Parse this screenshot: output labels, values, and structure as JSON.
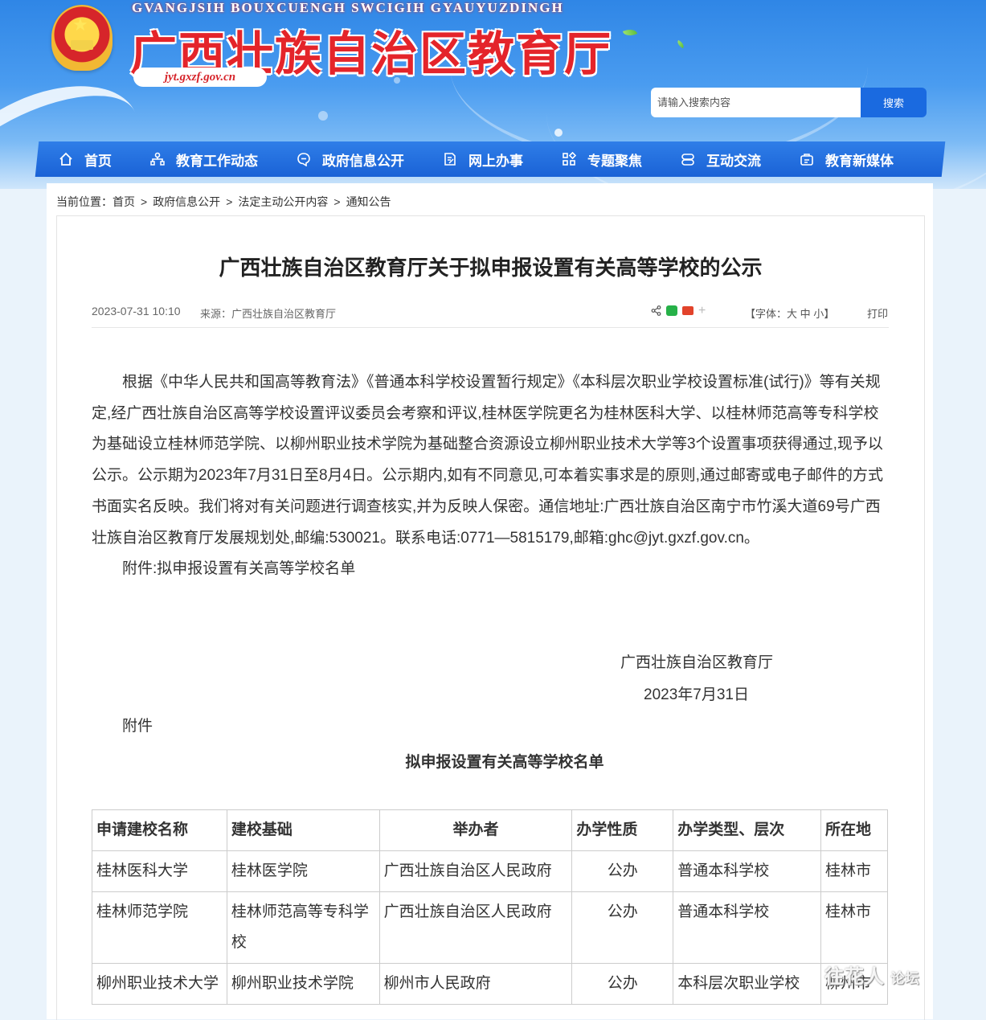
{
  "header": {
    "title": "广西壮族自治区教育厅",
    "subtitle": "GVANGJSIH BOUXCUENGH SWCIGIH GYAUYUZDINGH",
    "url": "jyt.gxzf.gov.cn"
  },
  "search": {
    "placeholder": "请输入搜索内容",
    "button": "搜索"
  },
  "nav": [
    {
      "label": "首页",
      "icon": "home-icon"
    },
    {
      "label": "教育工作动态",
      "icon": "org-icon"
    },
    {
      "label": "政府信息公开",
      "icon": "chat-icon"
    },
    {
      "label": "网上办事",
      "icon": "edit-doc-icon"
    },
    {
      "label": "专题聚焦",
      "icon": "grid-icon"
    },
    {
      "label": "互动交流",
      "icon": "dialog-icon"
    },
    {
      "label": "教育新媒体",
      "icon": "media-icon"
    }
  ],
  "breadcrumb": {
    "prefix": "当前位置：",
    "items": [
      "首页",
      "政府信息公开",
      "法定主动公开内容",
      "通知公告"
    ],
    "sep": ">"
  },
  "article": {
    "title": "广西壮族自治区教育厅关于拟申报设置有关高等学校的公示",
    "date": "2023-07-31 10:10",
    "source": "来源：广西壮族自治区教育厅",
    "font_label_open": "【字体：",
    "font_large": "大",
    "font_medium": "中",
    "font_small": "小",
    "font_label_close": "】",
    "print": "打印",
    "paragraph1": "根据《中华人民共和国高等教育法》《普通本科学校设置暂行规定》《本科层次职业学校设置标准(试行)》等有关规定,经广西壮族自治区高等学校设置评议委员会考察和评议,桂林医学院更名为桂林医科大学、以桂林师范高等专科学校为基础设立桂林师范学院、以柳州职业技术学院为基础整合资源设立柳州职业技术大学等3个设置事项获得通过,现予以公示。公示期为2023年7月31日至8月4日。公示期内,如有不同意见,可本着实事求是的原则,通过邮寄或电子邮件的方式书面实名反映。我们将对有关问题进行调查核实,并为反映人保密。通信地址:广西壮族自治区南宁市竹溪大道69号广西壮族自治区教育厅发展规划处,邮编:530021。联系电话:0771—5815179,邮箱:ghc@jyt.gxzf.gov.cn。",
    "attachment_line": "附件:拟申报设置有关高等学校名单",
    "signature_org": "广西壮族自治区教育厅",
    "signature_date": "2023年7月31日",
    "appendix_label": "附件",
    "list_title": "拟申报设置有关高等学校名单"
  },
  "table": {
    "headers": [
      "申请建校名称",
      "建校基础",
      "举办者",
      "办学性质",
      "办学类型、层次",
      "所在地"
    ],
    "rows": [
      [
        "桂林医科大学",
        "桂林医学院",
        "广西壮族自治区人民政府",
        "公办",
        "普通本科学校",
        "桂林市"
      ],
      [
        "桂林师范学院",
        "桂林师范高等专科学校",
        "广西壮族自治区人民政府",
        "公办",
        "普通本科学校",
        "桂林市"
      ],
      [
        "柳州职业技术大学",
        "柳州职业技术学院",
        "柳州市人民政府",
        "公办",
        "本科层次职业学校",
        "柳州市"
      ]
    ]
  },
  "watermark": {
    "main": "往花人",
    "small": "论坛"
  }
}
